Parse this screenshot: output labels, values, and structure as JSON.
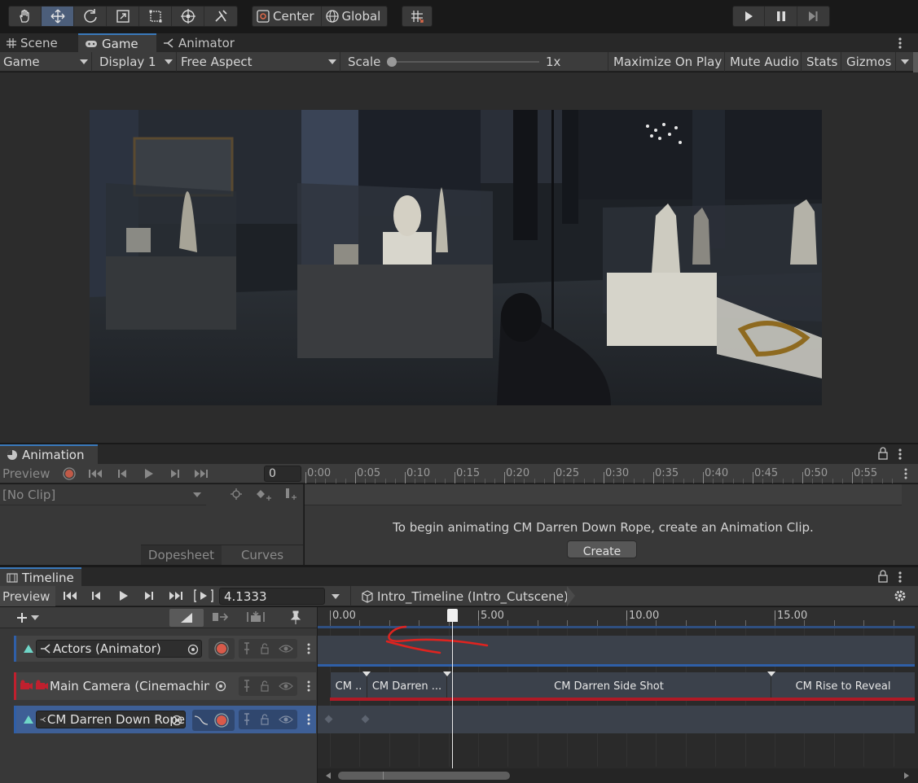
{
  "toolbar": {
    "tools": [
      "hand-tool",
      "move-tool",
      "rotate-tool",
      "scale-tool",
      "rect-tool",
      "transform-tool",
      "custom-tool"
    ],
    "pivot_label": "Center",
    "space_label": "Global"
  },
  "tabs": {
    "scene": "Scene",
    "game": "Game",
    "animator": "Animator"
  },
  "game_bar": {
    "view_mode": "Game",
    "display": "Display 1",
    "aspect": "Free Aspect",
    "scale_label": "Scale",
    "scale_value": "1x",
    "maximize_on_play": "Maximize On Play",
    "mute_audio": "Mute Audio",
    "stats": "Stats",
    "gizmos": "Gizmos"
  },
  "animation": {
    "title": "Animation",
    "preview_label": "Preview",
    "frame_value": "0",
    "ruler_ticks": [
      "0:00",
      "0:05",
      "0:10",
      "0:15",
      "0:20",
      "0:25",
      "0:30",
      "0:35",
      "0:40",
      "0:45",
      "0:50",
      "0:55"
    ],
    "clip_select": "[No Clip]",
    "dopesheet_tab": "Dopesheet",
    "curves_tab": "Curves",
    "message": "To begin animating CM Darren Down Rope, create an Animation Clip.",
    "create_button": "Create"
  },
  "timeline": {
    "title": "Timeline",
    "preview_label": "Preview",
    "time_value": "4.1333",
    "asset_name": "Intro_Timeline (Intro_Cutscene)",
    "ruler_ticks": [
      "0.00",
      "5.00",
      "10.00",
      "15.00"
    ],
    "playhead_time": 4.1333,
    "tracks": [
      {
        "name": "Actors (Animator)",
        "color": "#2f5fa8"
      },
      {
        "name": "Main Camera (Cinemachine",
        "color": "#c0202e"
      },
      {
        "name": "CM Darren Down Rope",
        "color": "#2f5fa8"
      }
    ],
    "camera_clips": [
      "CM ..",
      "CM Darren ...",
      "CM Darren Side Shot",
      "CM Rise to Reveal"
    ]
  },
  "colors": {
    "accent_blue": "#3a79bb",
    "record_red": "#d85a4a",
    "annotation_red": "#e0231f"
  }
}
